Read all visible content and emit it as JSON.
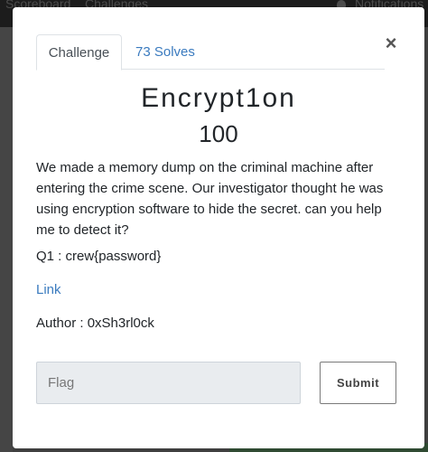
{
  "background": {
    "nav_links": [
      "Scoreboard",
      "Challenges"
    ],
    "notifications_label": "Notifications"
  },
  "modal": {
    "tabs": [
      {
        "label": "Challenge",
        "active": true
      },
      {
        "label": "73 Solves",
        "active": false
      }
    ],
    "close_label": "×",
    "title": "Encrypt1on",
    "points": "100",
    "description": "We made a memory dump on the criminal machine after entering the crime scene. Our investigator thought he was using encryption software to hide the secret. can you help me to detect it?",
    "question": "Q1 : crew{password}",
    "link_label": "Link",
    "author": "Author : 0xSh3rl0ck",
    "flag_input": {
      "value": "",
      "placeholder": "Flag"
    },
    "submit_label": "Submit"
  },
  "colors": {
    "link": "#3b7bbf",
    "overlay": "#3f3f3f",
    "input_bg": "#e9ecef"
  }
}
